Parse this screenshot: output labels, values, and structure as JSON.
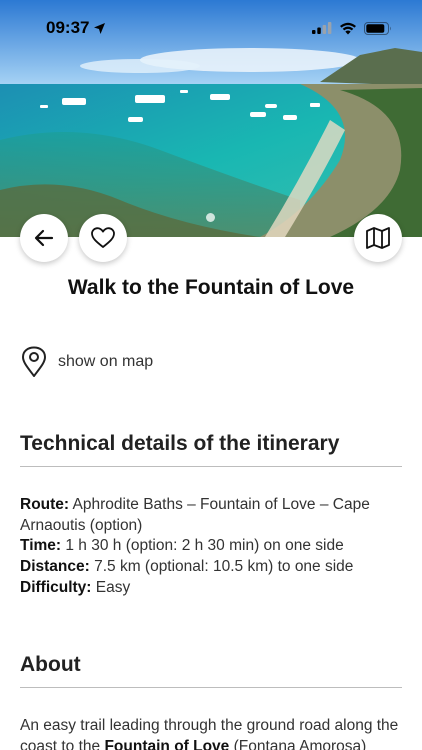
{
  "status_bar": {
    "time": "09:37"
  },
  "header": {
    "title": "Walk to the Fountain of Love"
  },
  "location": {
    "link_label": "show on map"
  },
  "technical": {
    "heading": "Technical details of the itinerary",
    "route_label": "Route:",
    "route_value": " Aphrodite Baths – Fountain of Love – Cape Arnaoutis (option)",
    "time_label": "Time:",
    "time_value": " 1 h 30 h (option: 2 h 30 min) on one side",
    "distance_label": "Distance:",
    "distance_value": " 7.5 km (optional: 10.5 km) to one side",
    "difficulty_label": "Difficulty:",
    "difficulty_value": " Easy"
  },
  "about": {
    "heading": "About",
    "text_start": "An easy trail leading through the ground road along the coast to the ",
    "text_bold": "Fountain of Love",
    "text_end": " (Fontana Amorosa)"
  },
  "icons": {
    "back": "arrow-left-icon",
    "favorite": "heart-icon",
    "map": "map-icon",
    "location": "location-pin-icon"
  }
}
